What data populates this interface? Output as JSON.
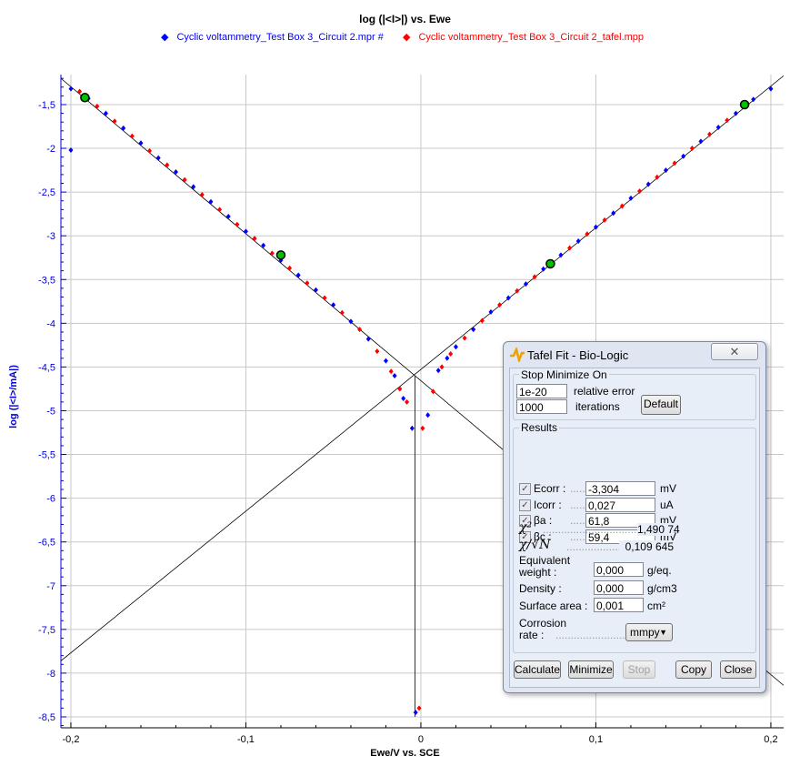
{
  "chart_data": {
    "type": "scatter",
    "title": "log (|<I>|) vs. Ewe",
    "xlabel": "Ewe/V vs. SCE",
    "ylabel": "log (|<I>/mA|)",
    "xlim": [
      -0.2057,
      0.2073
    ],
    "ylim": [
      -8.625,
      -1.157
    ],
    "xticks": [
      -0.2,
      -0.1,
      0,
      0.1,
      0.2
    ],
    "xtick_labels": [
      "-0,2",
      "-0,1",
      "0",
      "0,1",
      "0,2"
    ],
    "yticks": [
      -1.5,
      -2,
      -2.5,
      -3,
      -3.5,
      -4,
      -4.5,
      -5,
      -5.5,
      -6,
      -6.5,
      -7,
      -7.5,
      -8,
      -8.5
    ],
    "ytick_labels": [
      "-1,5",
      "-2",
      "-2,5",
      "-3",
      "-3,5",
      "-4",
      "-4,5",
      "-5",
      "-5,5",
      "-6",
      "-6,5",
      "-7",
      "-7,5",
      "-8",
      "-8,5"
    ],
    "grid": true,
    "legend_placement": "top",
    "series": [
      {
        "name": "Cyclic voltammetry_Test Box 3_Circuit 2.mpr #",
        "color": "#0000ff",
        "x": [
          -0.2,
          -0.2,
          -0.19,
          -0.18,
          -0.17,
          -0.16,
          -0.15,
          -0.14,
          -0.13,
          -0.12,
          -0.11,
          -0.1,
          -0.09,
          -0.08,
          -0.07,
          -0.06,
          -0.05,
          -0.04,
          -0.03,
          -0.02,
          -0.015,
          -0.01,
          -0.005,
          -0.003,
          0.004,
          0.01,
          0.015,
          0.02,
          0.03,
          0.04,
          0.05,
          0.06,
          0.07,
          0.08,
          0.09,
          0.1,
          0.11,
          0.12,
          0.13,
          0.14,
          0.15,
          0.16,
          0.17,
          0.18,
          0.19,
          0.2
        ],
        "y": [
          -1.32,
          -2.02,
          -1.43,
          -1.6,
          -1.77,
          -1.94,
          -2.11,
          -2.27,
          -2.44,
          -2.61,
          -2.78,
          -2.95,
          -3.11,
          -3.28,
          -3.45,
          -3.62,
          -3.79,
          -3.98,
          -4.18,
          -4.43,
          -4.6,
          -4.86,
          -5.2,
          -8.45,
          -5.05,
          -4.54,
          -4.4,
          -4.27,
          -4.07,
          -3.87,
          -3.71,
          -3.55,
          -3.38,
          -3.22,
          -3.06,
          -2.9,
          -2.74,
          -2.57,
          -2.41,
          -2.25,
          -2.09,
          -1.92,
          -1.76,
          -1.6,
          -1.44,
          -1.32
        ]
      },
      {
        "name": "Cyclic voltammetry_Test Box 3_Circuit 2_tafel.mpp",
        "color": "#ff0000",
        "x": [
          -0.195,
          -0.185,
          -0.175,
          -0.165,
          -0.155,
          -0.145,
          -0.135,
          -0.125,
          -0.115,
          -0.105,
          -0.095,
          -0.085,
          -0.075,
          -0.065,
          -0.055,
          -0.045,
          -0.035,
          -0.025,
          -0.017,
          -0.012,
          -0.008,
          -0.001,
          0.001,
          0.007,
          0.012,
          0.017,
          0.025,
          0.035,
          0.045,
          0.055,
          0.065,
          0.075,
          0.085,
          0.095,
          0.105,
          0.115,
          0.125,
          0.135,
          0.145,
          0.155,
          0.165,
          0.175,
          0.185
        ],
        "y": [
          -1.35,
          -1.52,
          -1.69,
          -1.86,
          -2.03,
          -2.19,
          -2.36,
          -2.53,
          -2.7,
          -2.87,
          -3.03,
          -3.2,
          -3.37,
          -3.54,
          -3.71,
          -3.88,
          -4.07,
          -4.32,
          -4.55,
          -4.75,
          -4.9,
          -8.4,
          -5.2,
          -4.78,
          -4.5,
          -4.35,
          -4.17,
          -3.97,
          -3.79,
          -3.63,
          -3.47,
          -3.3,
          -3.14,
          -2.98,
          -2.82,
          -2.66,
          -2.49,
          -2.33,
          -2.17,
          -2.0,
          -1.84,
          -1.68,
          -1.52
        ]
      }
    ],
    "fit_points": {
      "x": [
        -0.192,
        -0.08,
        0.074,
        0.185
      ],
      "y": [
        -1.42,
        -3.22,
        -3.32,
        -1.5
      ],
      "color": "#00c000"
    },
    "fit_lines": [
      {
        "x": [
          -0.2057,
          0.2073
        ],
        "y": [
          -7.86,
          -1.17
        ]
      },
      {
        "x": [
          -0.2057,
          0.2073
        ],
        "y": [
          -1.2,
          -8.14
        ]
      },
      {
        "x": [
          -0.0033,
          -0.0033
        ],
        "y": [
          -4.6,
          -8.5
        ]
      }
    ]
  },
  "dialog": {
    "title": "Tafel Fit - Bio-Logic",
    "close_glyph": "✕",
    "stop_group": "Stop Minimize On",
    "rel_error_value": "1e-20",
    "rel_error_label": "relative error",
    "iter_value": "1000",
    "iter_label": "iterations",
    "default_btn": "Default",
    "results_group": "Results",
    "rows": [
      {
        "label": "Ecorr :",
        "value": "-3,304",
        "unit": "mV",
        "checked": true
      },
      {
        "label": "Icorr :",
        "value": "0,027",
        "unit": "uA",
        "checked": true
      },
      {
        "label": "βa :",
        "value": "61,8",
        "unit": "mV",
        "checked": true
      },
      {
        "label": "βc :",
        "value": "59,4",
        "unit": "mV",
        "checked": true
      }
    ],
    "chi2_label": "χ²",
    "chi2_value": "1,490 74",
    "chin_label": "χ/√N",
    "chin_value": "0,109 645",
    "eqw_label1": "Equivalent",
    "eqw_label2": "weight :",
    "eqw_value": "0,000",
    "eqw_unit": "g/eq.",
    "density_label": "Density :",
    "density_value": "0,000",
    "density_unit": "g/cm3",
    "area_label": "Surface area :",
    "area_value": "0,001",
    "area_unit": "cm²",
    "corr_label1": "Corrosion",
    "corr_label2": "rate :",
    "corr_value": "mmpy",
    "buttons": [
      "Calculate",
      "Minimize",
      "Stop",
      "Copy",
      "Close"
    ]
  }
}
